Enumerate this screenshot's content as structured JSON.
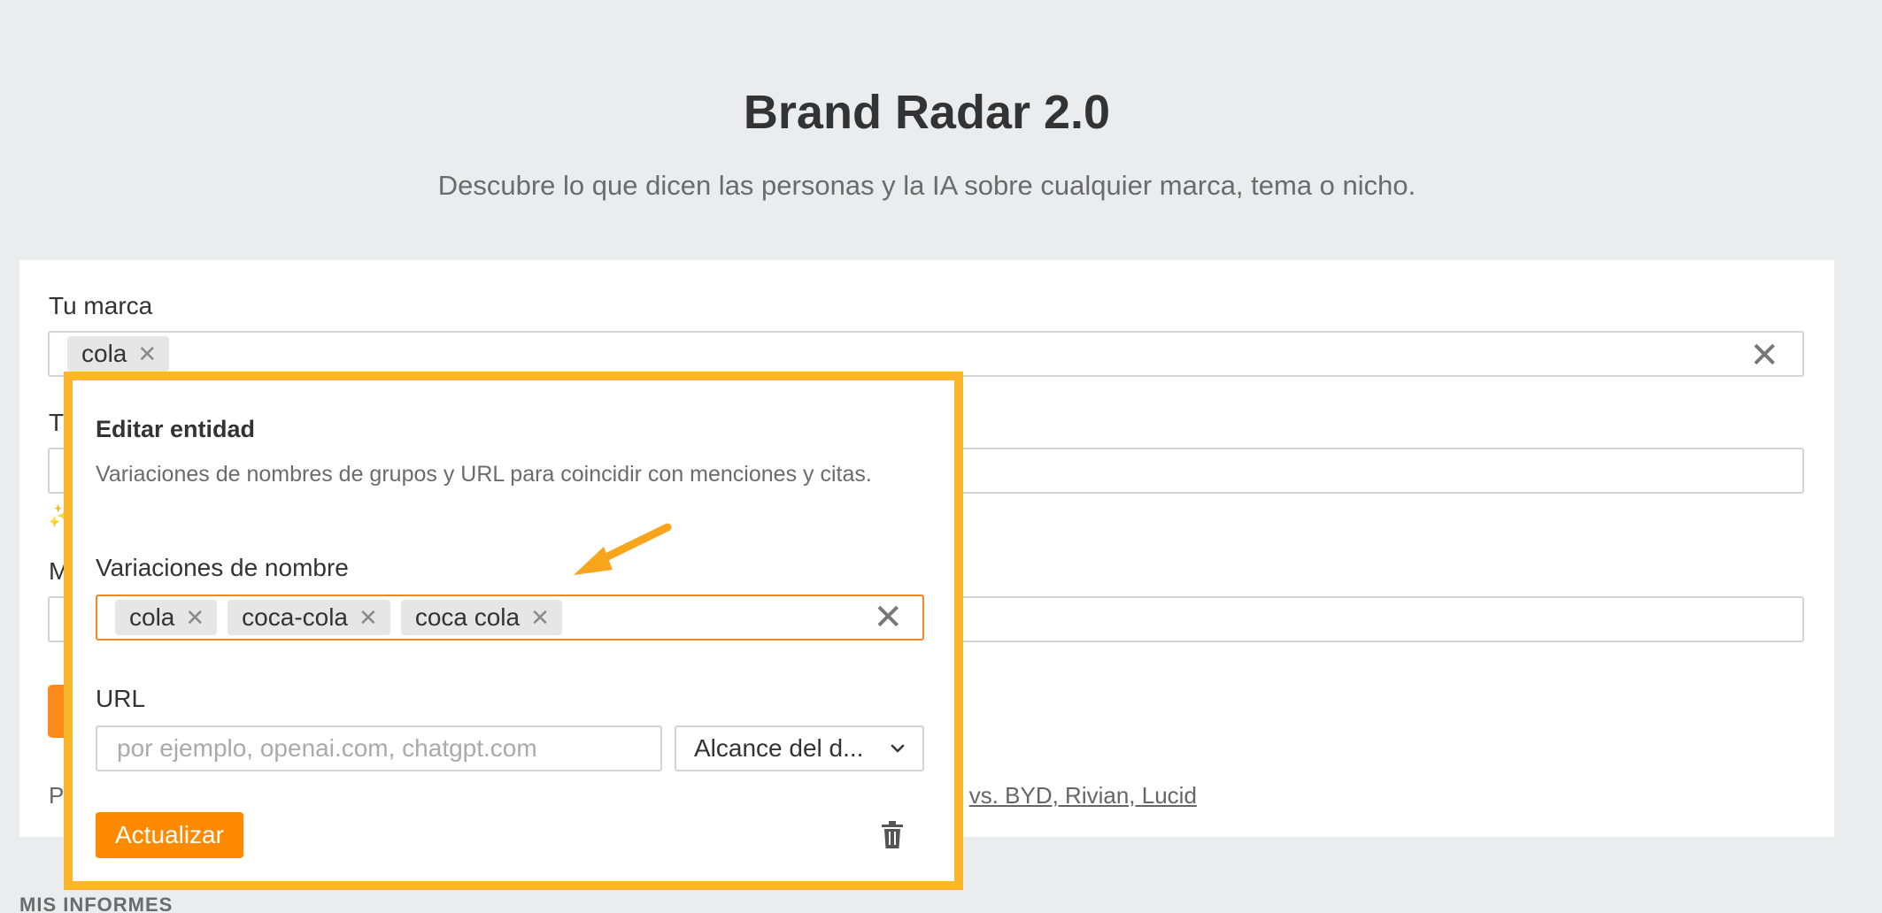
{
  "header": {
    "title": "Brand Radar 2.0",
    "subtitle": "Descubre lo que dicen las personas y la IA sobre cualquier marca, tema o nicho."
  },
  "form": {
    "brand_label": "Tu marca",
    "brand_chips": [
      "cola"
    ],
    "topic_label_partial": "Tu",
    "market_label_partial": "M",
    "footer_prefix": "P",
    "footer_link": "vs. BYD, Rivian, Lucid",
    "footer_link_partial": "e"
  },
  "popup": {
    "title": "Editar entidad",
    "description": "Variaciones de nombres de grupos y URL para coincidir con menciones y citas.",
    "names_label": "Variaciones de nombre",
    "name_chips": [
      "cola",
      "coca-cola",
      "coca cola"
    ],
    "url_label": "URL",
    "url_placeholder": "por ejemplo, openai.com, chatgpt.com",
    "scope_selected": "Alcance del d...",
    "update_button": "Actualizar"
  },
  "section": {
    "my_reports": "MIS INFORMES"
  },
  "colors": {
    "accent": "#ff8a00",
    "highlight_border": "#fbb62c",
    "arrow": "#f8a51c"
  },
  "icons": {
    "chip_remove": "close-icon",
    "field_clear": "close-icon",
    "scope_dropdown": "chevron-down-icon",
    "delete": "trash-icon",
    "sparkle": "sparkle-icon"
  }
}
